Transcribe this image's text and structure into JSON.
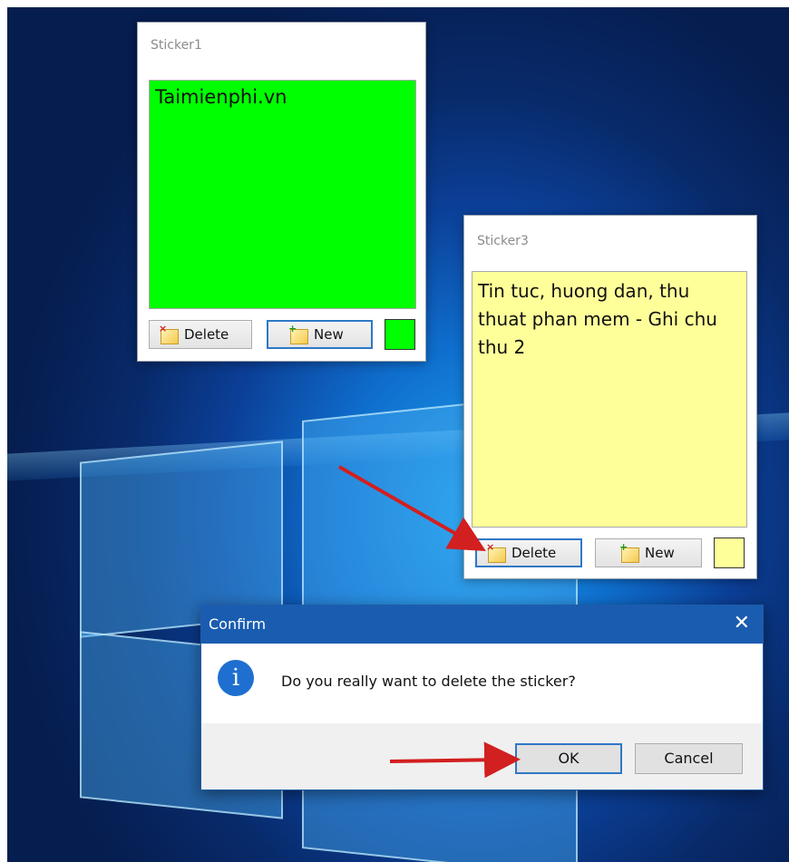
{
  "sticker1": {
    "title": "Sticker1",
    "note_text": "Taimienphi.vn",
    "note_color": "#00ff00",
    "delete_label": "Delete",
    "new_label": "New",
    "swatch_color": "#00ff00"
  },
  "sticker3": {
    "title": "Sticker3",
    "note_text": "Tin tuc, huong dan, thu thuat phan mem - Ghi chu thu 2",
    "note_color": "#ffff99",
    "delete_label": "Delete",
    "new_label": "New",
    "swatch_color": "#ffff99"
  },
  "confirm_dialog": {
    "title": "Confirm",
    "close_glyph": "✕",
    "icon_glyph": "i",
    "message": "Do you really want to delete the sticker?",
    "ok_label": "OK",
    "cancel_label": "Cancel"
  },
  "colors": {
    "accent": "#1a5cb0",
    "arrow": "#d21f1f"
  },
  "icons": {
    "delete": "delete-sticker-icon",
    "new": "new-sticker-icon",
    "info": "info-icon",
    "close": "close-icon"
  }
}
